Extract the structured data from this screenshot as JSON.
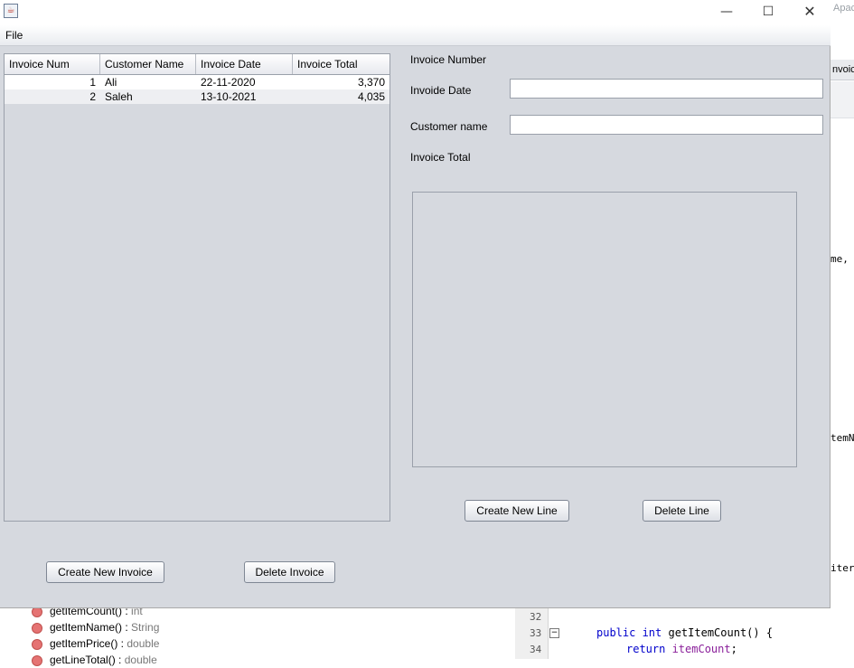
{
  "background": {
    "right_panel": {
      "top_text": "Apac",
      "header_text": "nvoic",
      "code_fragments": [
        "me,",
        "temN",
        "iter"
      ]
    },
    "navigator_items": [
      {
        "name": "getItemCount() :",
        "type": "int"
      },
      {
        "name": "getItemName() :",
        "type": "String"
      },
      {
        "name": "getItemPrice() :",
        "type": "double"
      },
      {
        "name": "getLineTotal() :",
        "type": "double"
      }
    ],
    "editor": {
      "line_numbers": [
        "32",
        "33",
        "34"
      ],
      "lines": [
        {
          "kw": "public int ",
          "rest": "getItemCount() {"
        },
        {
          "kw": "return ",
          "field": "itemCount",
          "rest": ";"
        }
      ]
    }
  },
  "window": {
    "menu": {
      "file": "File"
    },
    "invoices_table": {
      "columns": [
        "Invoice Num",
        "Customer Name",
        "Invoice Date",
        "Invoice Total"
      ],
      "rows": [
        {
          "num": "1",
          "customer": "Ali",
          "date": "22-11-2020",
          "total": "3,370"
        },
        {
          "num": "2",
          "customer": "Saleh",
          "date": "13-10-2021",
          "total": "4,035"
        }
      ]
    },
    "details": {
      "invoice_number_label": "Invoice Number",
      "invoice_date_label": "Invoide Date",
      "invoice_date_value": "",
      "customer_name_label": "Customer name",
      "customer_name_value": "",
      "invoice_total_label": "Invoice Total"
    },
    "buttons": {
      "create_new_line": "Create New Line",
      "delete_line": "Delete Line",
      "create_new_invoice": "Create New Invoice",
      "delete_invoice": "Delete Invoice"
    },
    "colors": {
      "window_bg": "#d6d9df",
      "row_selected": "#ffffff"
    }
  }
}
